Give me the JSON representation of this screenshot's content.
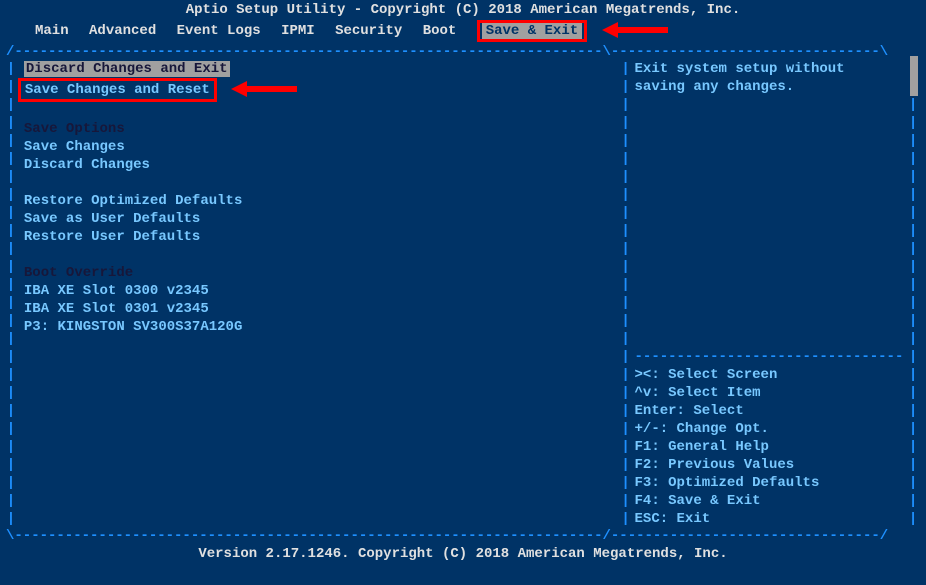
{
  "title": "Aptio Setup Utility - Copyright (C) 2018 American Megatrends, Inc.",
  "footer": "Version 2.17.1246. Copyright (C) 2018 American Megatrends, Inc.",
  "menu": {
    "items": [
      "Main",
      "Advanced",
      "Event Logs",
      "IPMI",
      "Security",
      "Boot",
      "Save & Exit"
    ],
    "active_index": 6
  },
  "left": {
    "discard_exit": "Discard Changes and Exit",
    "save_reset": "Save Changes and Reset",
    "save_options_header": "Save Options",
    "save_changes": "Save Changes",
    "discard_changes": "Discard Changes",
    "restore_optimized": "Restore Optimized Defaults",
    "save_user_defaults": "Save as User Defaults",
    "restore_user_defaults": "Restore User Defaults",
    "boot_override_header": "Boot Override",
    "boot1": "IBA XE Slot 0300 v2345",
    "boot2": "IBA XE Slot 0301 v2345",
    "boot3": "P3: KINGSTON SV300S37A120G"
  },
  "right": {
    "help_line1": "Exit system setup without",
    "help_line2": "saving any changes.",
    "keys": {
      "k1": "><: Select Screen",
      "k2": "^v: Select Item",
      "k3": "Enter: Select",
      "k4": "+/-: Change Opt.",
      "k5": "F1: General Help",
      "k6": "F2: Previous Values",
      "k7": "F3: Optimized Defaults",
      "k8": "F4: Save & Exit",
      "k9": "ESC: Exit"
    }
  }
}
